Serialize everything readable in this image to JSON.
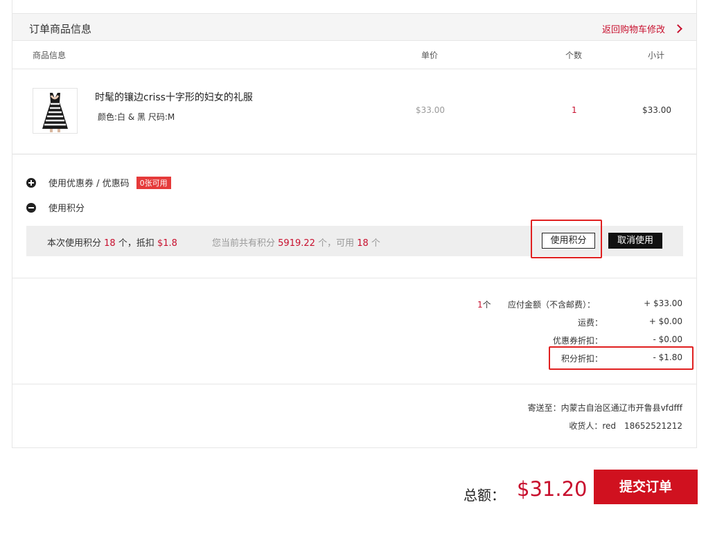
{
  "header": {
    "title": "订单商品信息",
    "back_link": "返回购物车修改"
  },
  "columns": {
    "info": "商品信息",
    "price": "单价",
    "qty": "个数",
    "subtotal": "小计"
  },
  "product": {
    "name": "时髦的镶边criss十字形的妇女的礼服",
    "attributes": "颜色:白 & 黑 尺码:M",
    "price": "$33.00",
    "qty": "1",
    "subtotal": "$33.00"
  },
  "options": {
    "coupon_label": "使用优惠券 / 优惠码",
    "coupon_badge": "0张可用",
    "points_label": "使用积分"
  },
  "points": {
    "use_prefix": "本次使用积分",
    "use_count": "18",
    "use_mid": "个，抵扣",
    "use_amount": "$1.8",
    "info_prefix": "您当前共有积分",
    "info_total": "5919.22",
    "info_mid": "个，可用",
    "info_avail": "18",
    "info_suffix": "个",
    "use_button": "使用积分",
    "cancel_button": "取消使用"
  },
  "summary": {
    "item_count": "1",
    "item_unit": "个",
    "payable_label": "应付金额（不含邮费）：",
    "payable_value": "+ $33.00",
    "shipping_label": "运费：",
    "shipping_value": "+ $0.00",
    "coupon_label": "优惠券折扣：",
    "coupon_value": "- $0.00",
    "points_label": "积分折扣：",
    "points_value": "- $1.80"
  },
  "shipping": {
    "address": "寄送至：内蒙古自治区通辽市开鲁县vfdfff",
    "receiver": "收货人：red　18652521212"
  },
  "footer": {
    "total_label": "总额：",
    "total_value": "$31.20",
    "submit_button": "提交订单"
  },
  "colors": {
    "accent": "#c8102e",
    "highlight": "#e02020"
  }
}
